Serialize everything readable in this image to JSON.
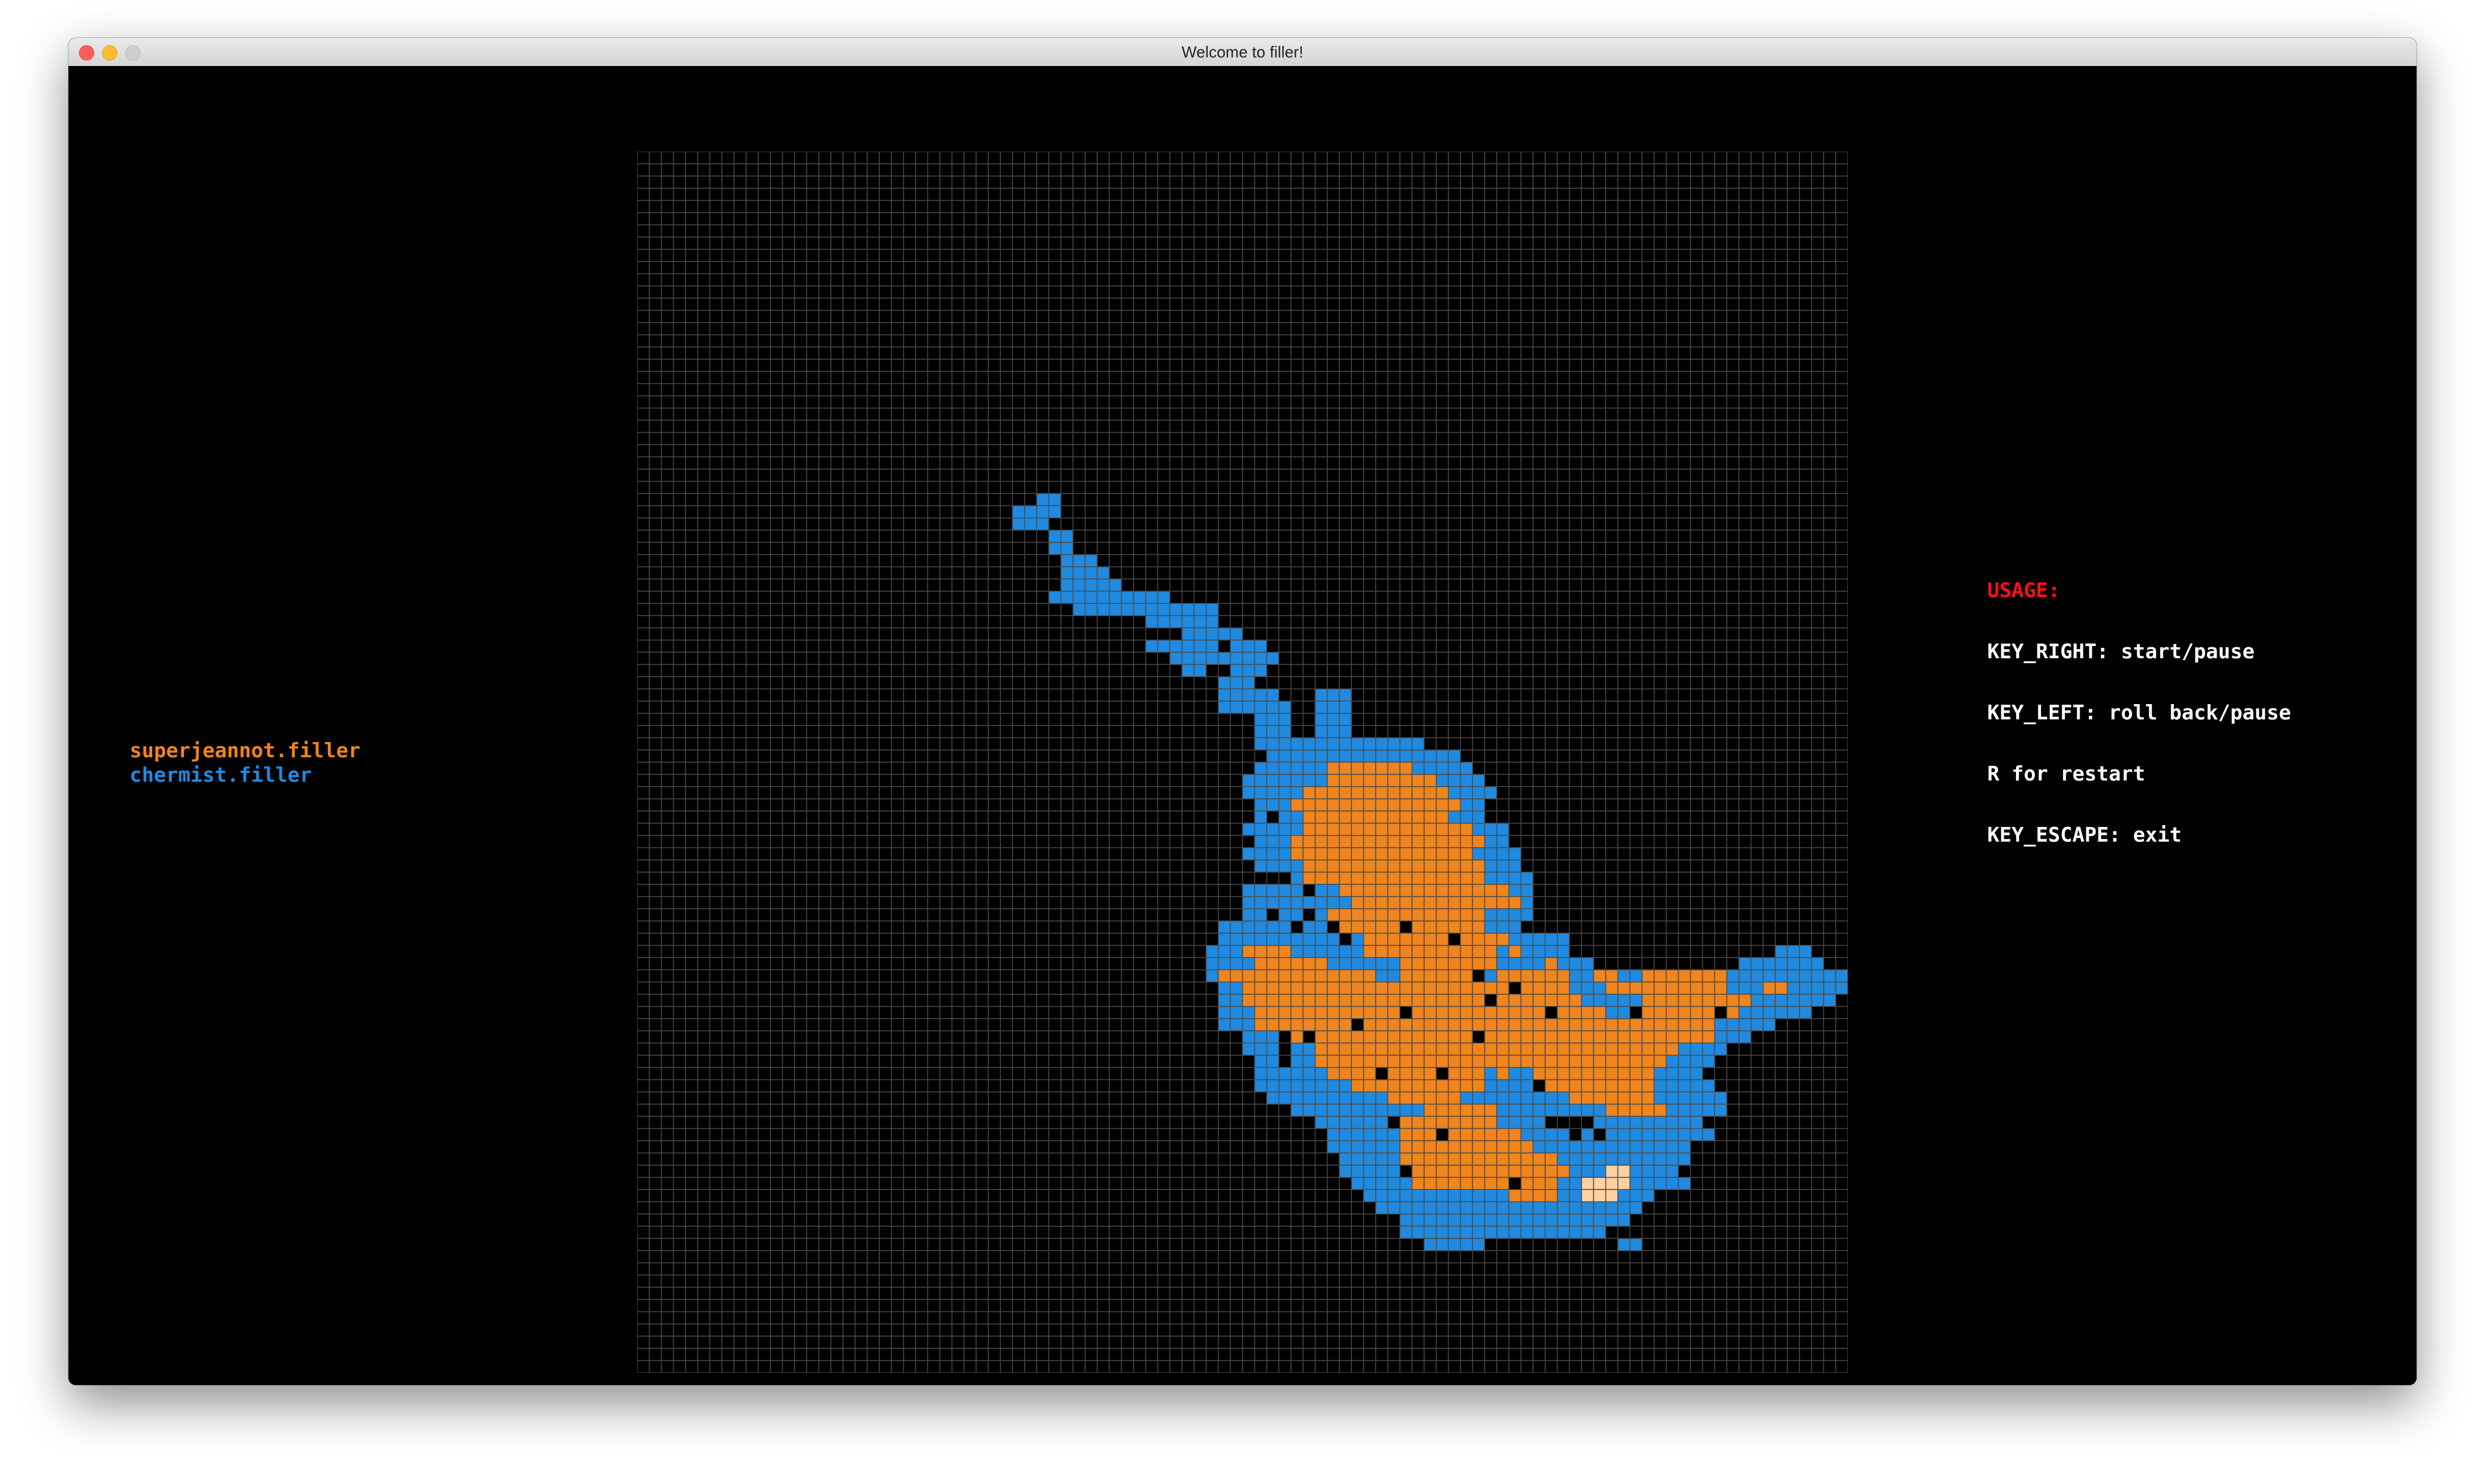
{
  "window": {
    "title": "Welcome to filler!"
  },
  "players": [
    {
      "name": "superjeannot.filler",
      "color": "#f0841d"
    },
    {
      "name": "chermist.filler",
      "color": "#1f8ae0"
    }
  ],
  "usage": {
    "heading": "USAGE:",
    "heading_color": "#ff0f1a",
    "lines": [
      "KEY_RIGHT: start/pause",
      "KEY_LEFT: roll back/pause",
      "R for restart",
      "KEY_ESCAPE: exit"
    ]
  },
  "board": {
    "cols": 100,
    "rows": 100,
    "grid_color": "#4a4a4a",
    "cell_colors": {
      "O": "#f0841d",
      "X": "#1f8ae0",
      "N": "#ffd0a0",
      "B": "#000000"
    },
    "rows_data": [
      "....................................................................................................",
      "....................................................................................................",
      "....................................................................................................",
      "....................................................................................................",
      "....................................................................................................",
      "....................................................................................................",
      "....................................................................................................",
      "....................................................................................................",
      "....................................................................................................",
      "....................................................................................................",
      "....................................................................................................",
      "....................................................................................................",
      "....................................................................................................",
      "....................................................................................................",
      "....................................................................................................",
      "....................................................................................................",
      "....................................................................................................",
      "....................................................................................................",
      "....................................................................................................",
      "....................................................................................................",
      "....................................................................................................",
      "....................................................................................................",
      "....................................................................................................",
      "....................................................................................................",
      "....................................................................................................",
      "....................................................................................................",
      "....................................................................................................",
      "....................................................................................................",
      ".................................XX.................................................................",
      "...............................XXXX.................................................................",
      "...............................XXX..................................................................",
      "..................................XX................................................................",
      "..................................XX................................................................",
      "...................................XXX..............................................................",
      "...................................XXXX.............................................................",
      "...................................XXXXX............................................................",
      "..................................XXXXXXXXXX........................................................",
      "....................................XXXXXXXXXXXX....................................................",
      "..........................................XXXXXX....................................................",
      ".............................................XXXXX..................................................",
      "..........................................XXXXXX.XXX................................................",
      "............................................XXXXXXXXX...............................................",
      ".............................................XX..XXX................................................",
      "................................................XXX.................................................",
      "................................................XXXXX...XXX.........................................",
      "................................................XXXXXX..XXX.........................................",
      "...................................................XXX..XXX.........................................",
      "...................................................XXX..XXX.........................................",
      "...................................................XXXXXXXXXXXXXX...................................",
      "....................................................XXXXXXXXXXXXXXXX.................................",
      "...................................................XXXXXXOOOOOOOXXXXX................................",
      "..................................................XXXXXXXOOOOOOOOOXXXX...............................",
      "..................................................XXXXXOOOOOOOOOOOOXXXX..............................",
      "...................................................XXXOOOOOOOOOOOOOOXX...............................",
      "...................................................XBXXOOOOOOOOOOOOXXX...............................",
      "..................................................XXXXXOOOOOOOOOOOOOOXXX............................",
      "...................................................XXXOOOOOOOOOOOOOOOOXX............................",
      "..................................................XXXXOOOOOOOOOOOOOOOXXXX...........................",
      "...................................................XXXXOOOOOOOOOOOOOOOXXX...........................",
      "......................................................XOOOOOOOOOOOOOOOXXXX..........................",
      "..................................................XXXXXBXXOOOOOOOOOOOOOOXX..........................",
      "..................................................XXXXXXXXXOOOOOOOOOOOOOOX..........................",
      "..................................................XXBXXBXOOOOOOOOOOOOOXXXX..........................",
      "................................................XXXXXXBXXBOOOOOBOOOOOOXXX...........................",
      "................................................XXXXXXXXXXBXOOOOOOOBOOOOXXXXX.......................",
      "...............................................XXXOOOOXXXXXXOOOOOOOOOOOXOXXXX.................XXX...",
      "...............................................XXXXOOOOOOXXXXXXOOOOOOOOXXXXOXXX............XXXXXXX.",
      "...............................................XOOOOOOOOOOOOOXXOOOOOOBXOOOOOOXXOOXXOOOOOOOXXXXXXXXXX",
      "................................................XXOOOOOOOOOOOOOOOOOOOOOOBOOOOXXXOOOOOOOOOOXXXOOXXXXX",
      "................................................XXOOOOOOOOOOOOOOOOOOOOBOOOOOOOXXXXXOOOOOOOOOXXXXXXX.",
      "................................................XXXOOOOOOOOOOOOBOOOOOOOOOOOBOOOOXXBOOOOOOBOXXXXXX...",
      "................................................XXXOOOOOOOOBOOOOOOOOOOOOOOOOOOOOOOOOOOOOOXXXXX.....",
      "..................................................XXXBOBOOOOOOOOOOOOOBOOOOOOOOOOOOOOOOOOOXXX........",
      "..................................................XXXBXXOOOOOOOOOOOOOOOOOOOOOOOOOOOOOOXXXX.........",
      "...................................................XXBXXOOOOOOOOOOOOOOOOOOOOOOOOOOOOOXXXX..........",
      "...................................................XXXXXXOOOOBOOOOBOOOXOXXOOOOOOOOOOXXXX...........",
      "...................................................XXXXXXXXOOOOOOOOOOOXXXXBOOOOOOOOOXXXXX...........",
      "....................................................XXXXXXXXXXOOOOOOXXXXXXXXXOOOOOOOXXXXXX..........",
      "......................................................XXXXXXXXXXXOOOOOOXXXXXXXXXOOOOOXXXXX..........",
      "........................................................XXXXXXBOOOOOOOOXXXXBBBBXXXXXXXXX............",
      ".........................................................XXXXXXOOOBOOOOOOXXXXBXBXXXXXXXXX...........",
      ".........................................................XXXXXXOOOOOOOOOOOXXXXXXXXXXXXX.............",
      "..........................................................XXXXXOOOOOOOOOOOOOXXXXXXXXXXX.............",
      "..........................................................XXXXXBOOOOOOOOOOOOOXXXNNXXXX.............",
      "...........................................................XXXXXOOOOOOOOBOOOXXNNNNXXXXX............",
      "............................................................XXXXXXXXXXXXOOOOXXNNNXXX...............",
      ".............................................................XXXXXXXXXXXXXXXXXXXXXX.................",
      "...............................................................XXXXXXXXXXXXXXXXXXX..................",
      "...............................................................XXXXXXXXXXXXXXXXX....................",
      ".................................................................XXXXX...........XX..................",
      "....................................................................................................",
      "....................................................................................................",
      "....................................................................................................",
      "....................................................................................................",
      "....................................................................................................",
      "....................................................................................................",
      "....................................................................................................",
      "....................................................................................................",
      "....................................................................................................",
      "...................................................................................................."
    ]
  }
}
